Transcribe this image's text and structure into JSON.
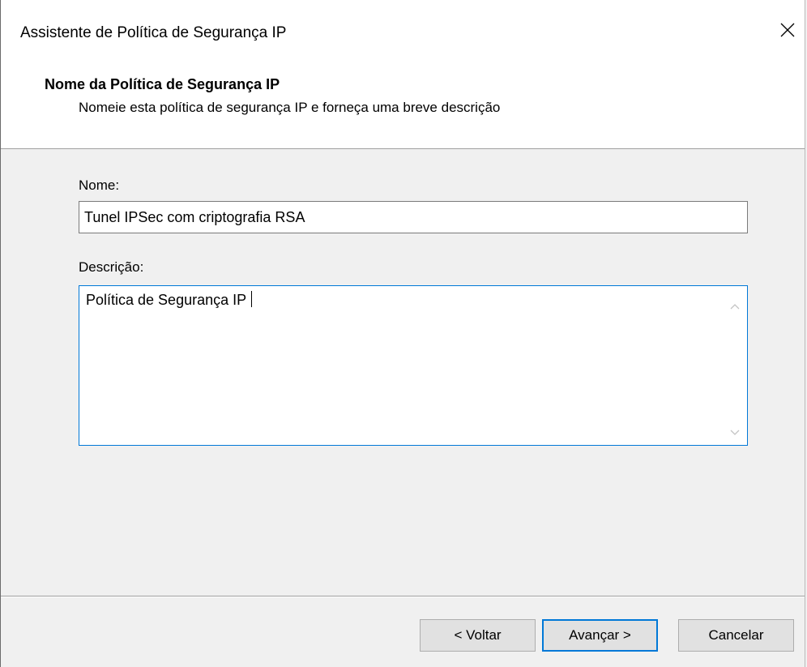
{
  "window": {
    "title": "Assistente de Política de Segurança IP",
    "close_icon": "close-icon"
  },
  "header": {
    "title": "Nome da Política de Segurança IP",
    "subtitle": "Nomeie esta política de segurança IP e forneça uma breve descrição"
  },
  "form": {
    "name_label": "Nome:",
    "name_value": "Tunel IPSec com criptografia RSA",
    "description_label": "Descrição:",
    "description_value": "Política de Segurança IP"
  },
  "buttons": {
    "back_label": "< Voltar",
    "next_label": "Avançar >",
    "cancel_label": "Cancelar"
  },
  "colors": {
    "focus_accent": "#0078d7",
    "header_background": "#ffffff",
    "body_background": "#f0f0f0"
  }
}
